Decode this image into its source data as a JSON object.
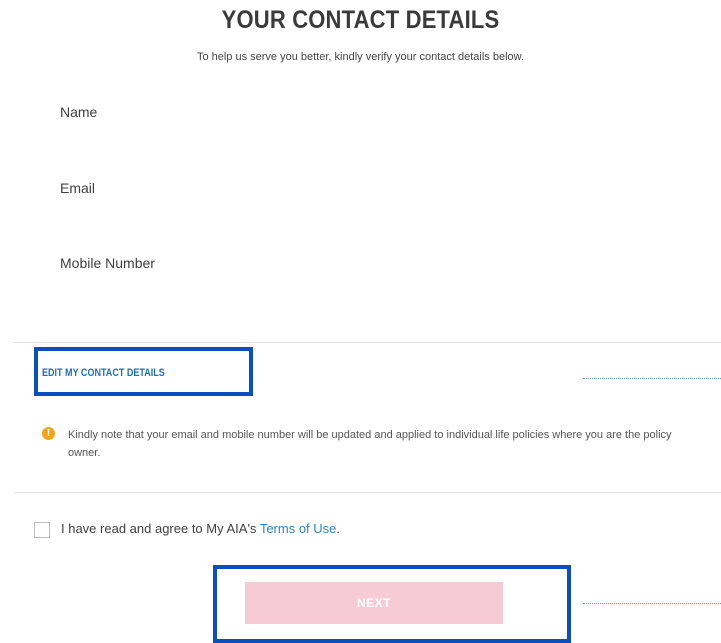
{
  "header": {
    "title": "YOUR CONTACT DETAILS",
    "subtitle": "To help us serve you better, kindly verify your contact details below."
  },
  "fields": {
    "name_label": "Name",
    "email_label": "Email",
    "mobile_label": "Mobile Number"
  },
  "edit": {
    "link_label": "EDIT MY CONTACT DETAILS"
  },
  "notice": {
    "icon": "!",
    "text": "Kindly note that your email and mobile number will be updated and applied to individual life policies where you are the policy owner."
  },
  "consent": {
    "prefix": "I have read and agree to My AIA's ",
    "link": "Terms of Use",
    "suffix": ".",
    "checked": false
  },
  "actions": {
    "next_label": "NEXT",
    "next_enabled": false
  },
  "colors": {
    "accent_link": "#1f6fb5",
    "terms_link": "#2a84c9",
    "highlight_box": "#0a4fc0",
    "next_disabled_bg": "#f7cbd6",
    "notice_icon": "#f4a41c"
  }
}
